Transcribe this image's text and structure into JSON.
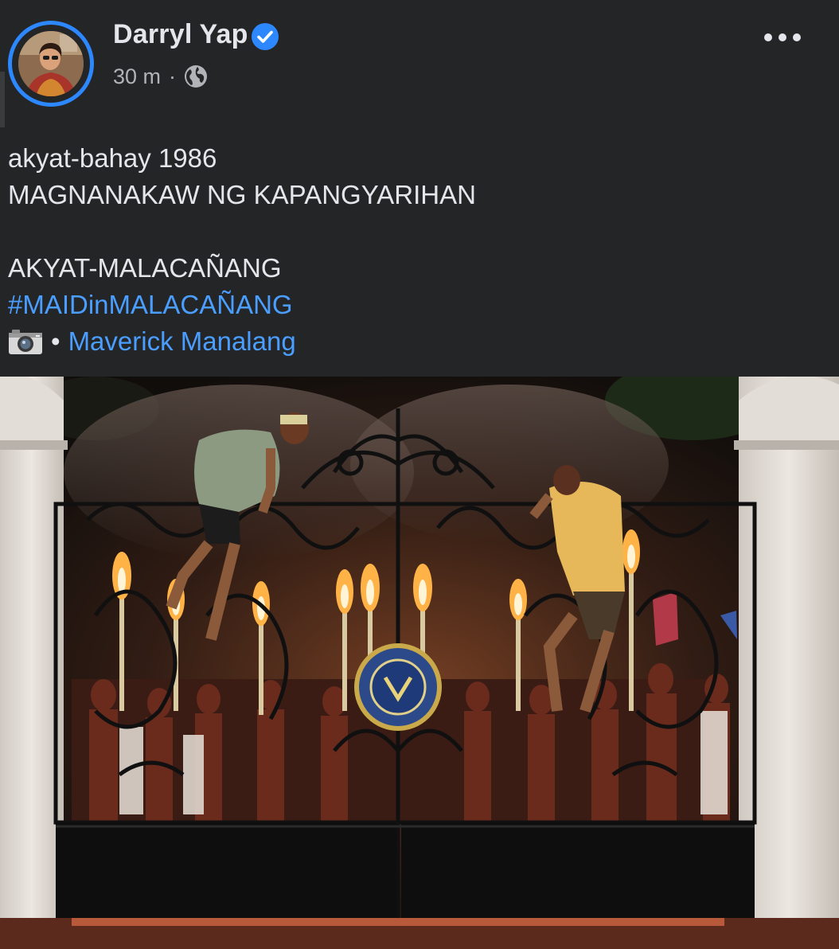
{
  "post": {
    "author": "Darryl Yap",
    "timestamp": "30 m",
    "separator": "·",
    "audience_icon": "globe-icon",
    "verified_icon": "verified-badge-icon",
    "more_icon": "ellipsis-icon",
    "lines": [
      "akyat-bahay 1986",
      "MAGNANAKAW NG KAPANGYARIHAN",
      "",
      "AKYAT-MALACAÑANG"
    ],
    "hashtag": "#MAIDinMALACAÑANG",
    "credit": {
      "icon": "camera-icon",
      "bullet": "•",
      "name": "Maverick Manalang"
    }
  },
  "colors": {
    "background": "#242526",
    "text": "#e4e6eb",
    "secondary_text": "#b0b3b8",
    "link": "#4a9eff",
    "accent": "#2d88ff"
  }
}
